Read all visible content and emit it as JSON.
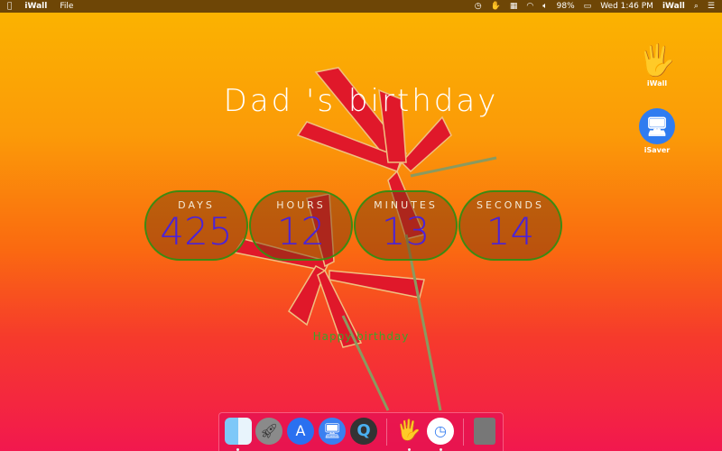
{
  "menubar": {
    "apple": "",
    "app": "iWall",
    "file": "File",
    "battery": "98%",
    "clock": "Wed 1:46 PM",
    "app_right": "iWall"
  },
  "title": "Dad 's birthday",
  "countdown": [
    {
      "label": "DAYS",
      "value": "425"
    },
    {
      "label": "HOURS",
      "value": "12"
    },
    {
      "label": "MINUTES",
      "value": "13"
    },
    {
      "label": "SECONDS",
      "value": "14"
    }
  ],
  "message": "Happy birthday",
  "desktop": [
    {
      "label": "iWall"
    },
    {
      "label": "iSaver"
    }
  ],
  "dock": [
    "Finder",
    "Launchpad",
    "App Store",
    "iSaver",
    "QuickTime Player",
    "iWall",
    "Clock",
    "Trash"
  ]
}
